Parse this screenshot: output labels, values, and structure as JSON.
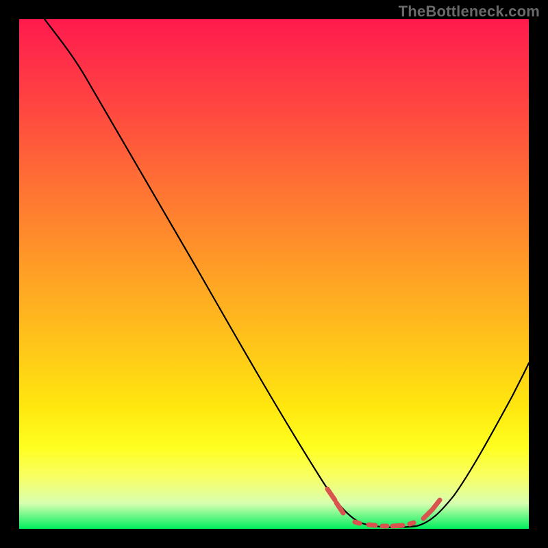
{
  "watermark": "TheBottleneck.com",
  "chart_data": {
    "type": "line",
    "title": "",
    "xlabel": "",
    "ylabel": "",
    "xlim": [
      0,
      100
    ],
    "ylim": [
      0,
      100
    ],
    "series": [
      {
        "name": "curve",
        "x": [
          5,
          10,
          15,
          20,
          25,
          30,
          35,
          40,
          45,
          50,
          55,
          60,
          62,
          65,
          70,
          75,
          78,
          82,
          86,
          90,
          94,
          100
        ],
        "values": [
          100,
          96,
          90,
          82,
          74,
          66,
          58,
          50,
          42,
          33,
          24,
          15,
          11,
          6,
          2,
          1,
          1,
          1,
          4,
          10,
          18,
          32
        ]
      }
    ],
    "highlight_range_x": [
      62,
      78
    ],
    "gradient_stops": [
      {
        "pos": 0,
        "color": "#ff1a4d"
      },
      {
        "pos": 42,
        "color": "#ff8a2c"
      },
      {
        "pos": 84,
        "color": "#ffff20"
      },
      {
        "pos": 100,
        "color": "#00ef5e"
      }
    ]
  }
}
